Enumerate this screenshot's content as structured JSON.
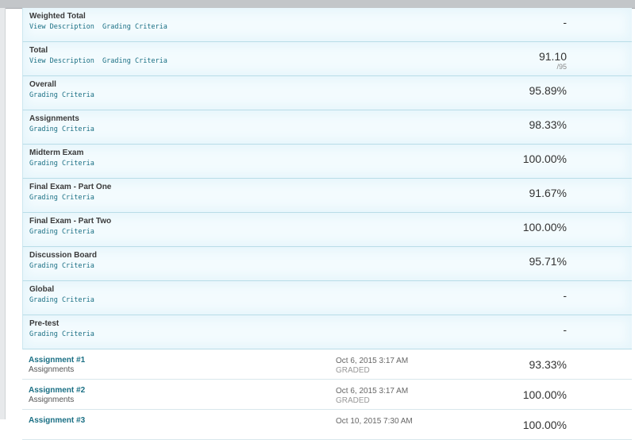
{
  "links": {
    "view_description": "View Description",
    "grading_criteria": "Grading Criteria"
  },
  "rows": [
    {
      "title": "Weighted Total",
      "score": "-"
    },
    {
      "title": "Total",
      "score": "91.10",
      "out_of": "/95"
    },
    {
      "title": "Overall",
      "score": "95.89%"
    },
    {
      "title": "Assignments",
      "score": "98.33%"
    },
    {
      "title": "Midterm Exam",
      "score": "100.00%"
    },
    {
      "title": "Final Exam - Part One",
      "score": "91.67%"
    },
    {
      "title": "Final Exam - Part Two",
      "score": "100.00%"
    },
    {
      "title": "Discussion Board",
      "score": "95.71%"
    },
    {
      "title": "Global",
      "score": "-"
    },
    {
      "title": "Pre-test",
      "score": "-"
    }
  ],
  "assignments": [
    {
      "title": "Assignment #1",
      "category": "Assignments",
      "date": "Oct 6, 2015 3:17 AM",
      "status": "GRADED",
      "score": "93.33%"
    },
    {
      "title": "Assignment #2",
      "category": "Assignments",
      "date": "Oct 6, 2015 3:17 AM",
      "status": "GRADED",
      "score": "100.00%"
    },
    {
      "title": "Assignment #3",
      "category": "",
      "date": "Oct 10, 2015 7:30 AM",
      "status": "",
      "score": "100.00%"
    }
  ]
}
